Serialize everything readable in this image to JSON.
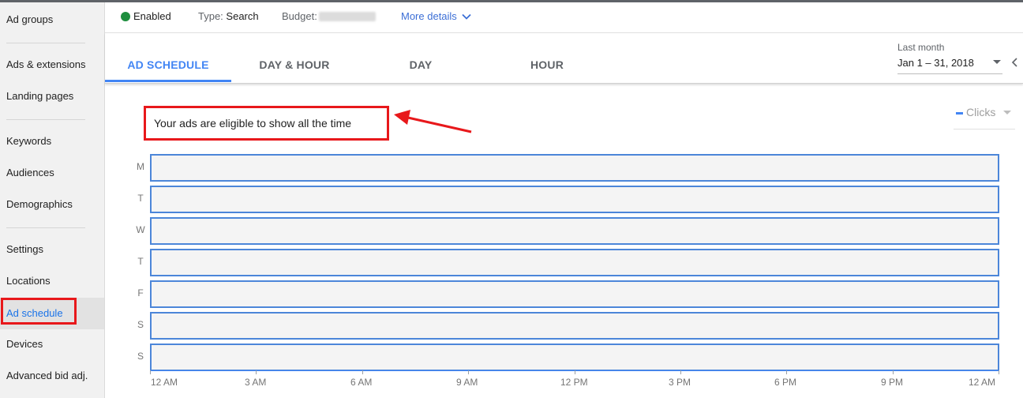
{
  "sidebar": {
    "items": [
      {
        "label": "Ad groups"
      },
      {
        "label": "Ads & extensions"
      },
      {
        "label": "Landing pages"
      },
      {
        "label": "Keywords"
      },
      {
        "label": "Audiences"
      },
      {
        "label": "Demographics"
      },
      {
        "label": "Settings"
      },
      {
        "label": "Locations"
      },
      {
        "label": "Ad schedule",
        "active": true
      },
      {
        "label": "Devices"
      },
      {
        "label": "Advanced bid adj."
      }
    ]
  },
  "infobar": {
    "status": "Enabled",
    "status_color": "#1e8e3e",
    "type_label": "Type:",
    "type_value": "Search",
    "budget_label": "Budget:",
    "more_details": "More details",
    "more_icon": "chevron-down-icon"
  },
  "tabs": [
    {
      "label": "AD SCHEDULE",
      "active": true
    },
    {
      "label": "DAY & HOUR"
    },
    {
      "label": "DAY"
    },
    {
      "label": "HOUR"
    }
  ],
  "date": {
    "label": "Last month",
    "range": "Jan 1 – 31, 2018"
  },
  "schedule": {
    "message": "Your ads are eligible to show all the time",
    "metric": "Clicks",
    "days": [
      "M",
      "T",
      "W",
      "T",
      "F",
      "S",
      "S"
    ],
    "hours": [
      "12 AM",
      "3 AM",
      "6 AM",
      "9 AM",
      "12 PM",
      "3 PM",
      "6 PM",
      "9 PM",
      "12 AM"
    ]
  },
  "colors": {
    "accent": "#4285f4",
    "annotation": "#e8181b",
    "bar_fill": "#f4f4f4",
    "bar_border": "#4c86d9"
  }
}
